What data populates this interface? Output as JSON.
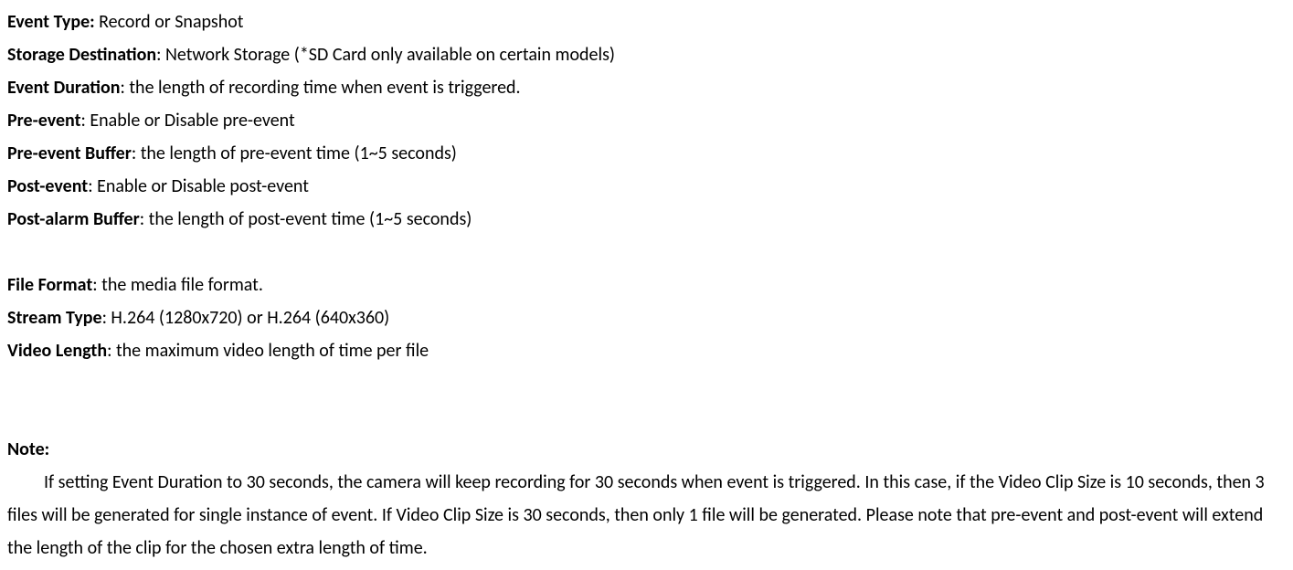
{
  "fields": {
    "eventType": {
      "label": "Event Type:",
      "value": " Record or Snapshot"
    },
    "storageDestination": {
      "label": "Storage Destination",
      "value": ": Network Storage (*SD Card only available on certain models)"
    },
    "eventDuration": {
      "label": "Event Duration",
      "value": ": the length of recording time when event is triggered."
    },
    "preEvent": {
      "label": "Pre-event",
      "value": ": Enable or Disable pre-event"
    },
    "preEventBuffer": {
      "label": "Pre-event Buffer",
      "value": ": the length of pre-event time (1~5 seconds)"
    },
    "postEvent": {
      "label": "Post-event",
      "value": ": Enable or Disable post-event"
    },
    "postAlarmBuffer": {
      "label": "Post-alarm Buffer",
      "value": ": the length of post-event time (1~5 seconds)"
    },
    "fileFormat": {
      "label": "File Format",
      "value": ": the media file format."
    },
    "streamType": {
      "label": "Stream Type",
      "value": ": H.264 (1280x720) or H.264 (640x360)"
    },
    "videoLength": {
      "label": "Video Length",
      "value": ": the maximum video length of time per file"
    }
  },
  "note": {
    "label": "Note:",
    "body": "If setting Event Duration to 30 seconds, the camera will keep recording for 30 seconds when event is triggered. In this case, if the Video Clip Size is 10 seconds, then 3 files will be generated for single instance of event. If Video Clip Size is 30 seconds, then only 1 file will be generated. Please note that pre-event and post-event will extend the length of the clip for the chosen extra length of time."
  }
}
